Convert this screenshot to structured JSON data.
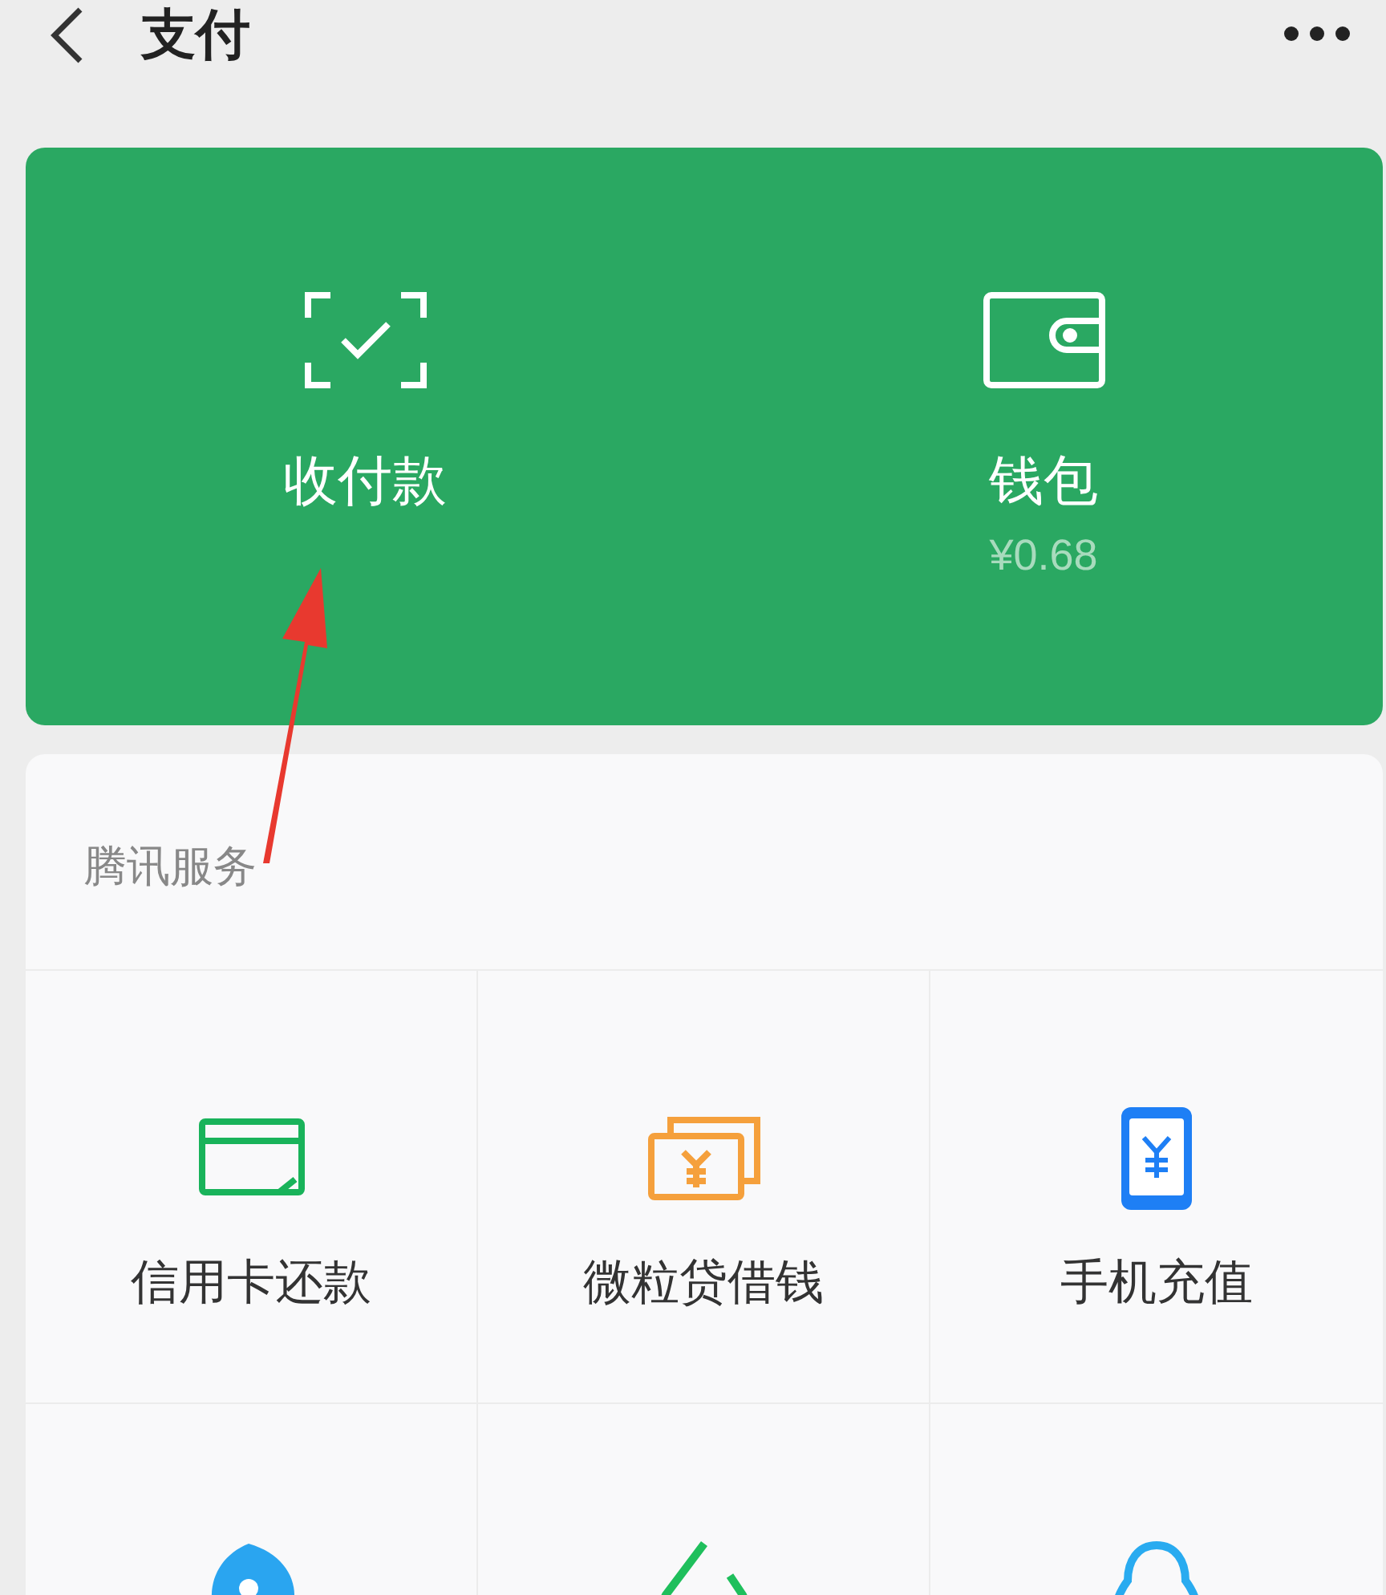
{
  "header": {
    "title": "支付"
  },
  "hero": [
    {
      "kind": "scan",
      "label": "收付款"
    },
    {
      "kind": "wallet",
      "label": "钱包",
      "amount": "¥0.68"
    }
  ],
  "services": {
    "title": "腾讯服务",
    "items": [
      {
        "kind": "card",
        "label": "信用卡还款"
      },
      {
        "kind": "cash",
        "label": "微粒贷借钱"
      },
      {
        "kind": "phone",
        "label": "手机充值"
      },
      {
        "kind": "drop"
      },
      {
        "kind": "leaf"
      },
      {
        "kind": "penguin"
      }
    ]
  }
}
